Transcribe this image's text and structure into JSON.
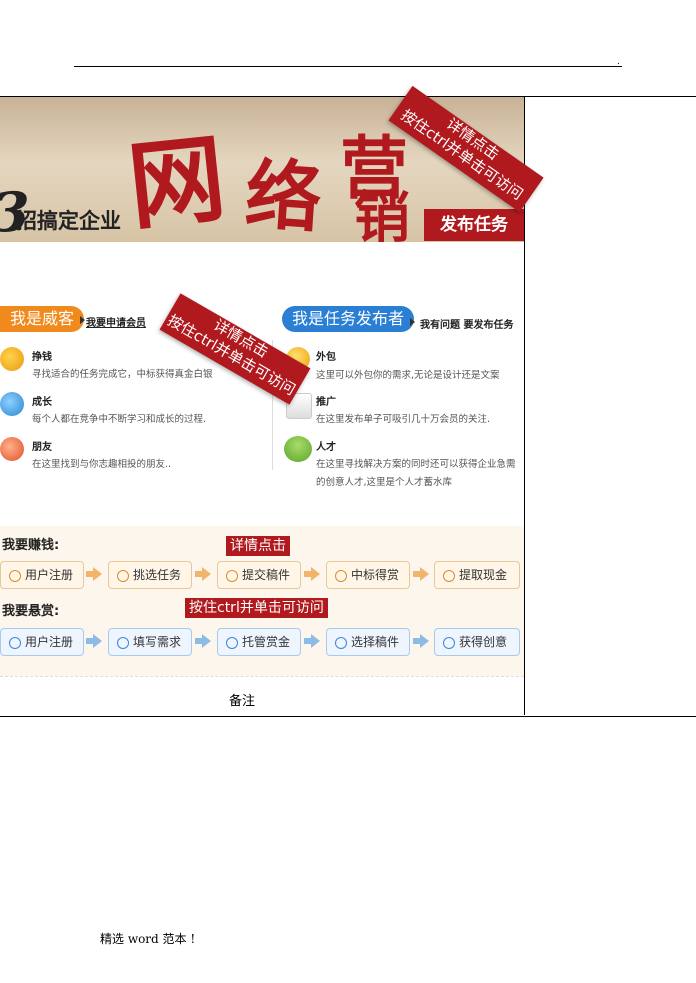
{
  "header": {
    "dot": "."
  },
  "banner": {
    "big_number": "3",
    "subtitle": "招搞定企业",
    "calligraphy": [
      "网",
      "络",
      "营",
      "销"
    ],
    "publish_button": "发布任务",
    "ribbon_top": "详情点击",
    "ribbon_bottom": "按住ctrl并单击可访问"
  },
  "left_panel": {
    "pill": "我是威客",
    "link": "我要申请会员",
    "items": [
      {
        "title": "挣钱",
        "desc": "寻找适合的任务完成它，中标获得真金白银"
      },
      {
        "title": "成长",
        "desc": "每个人都在竞争中不断学习和成长的过程."
      },
      {
        "title": "朋友",
        "desc": "在这里找到与你志趣相投的朋友.."
      }
    ]
  },
  "right_panel": {
    "pill": "我是任务发布者",
    "link": "我有问题 要发布任务",
    "items": [
      {
        "title": "外包",
        "desc": "这里可以外包你的需求,无论是设计还是文案"
      },
      {
        "title": "推广",
        "desc": "在这里发布单子可吸引几十万会员的关注."
      },
      {
        "title": "人才",
        "desc": "在这里寻找解决方案的同时还可以获得企业急需",
        "desc2": "的创意人才,这里是个人才蓄水库"
      }
    ]
  },
  "mid_ribbon": {
    "line1": "详情点击",
    "line2": "按住ctrl并单击可访问"
  },
  "flows": {
    "earn_label": "我要赚钱:",
    "earn_steps": [
      "用户注册",
      "挑选任务",
      "提交稿件",
      "中标得赏",
      "提取现金"
    ],
    "reward_label": "我要悬赏:",
    "reward_steps": [
      "用户注册",
      "填写需求",
      "托管赏金",
      "选择稿件",
      "获得创意"
    ],
    "tag_top": "详情点击",
    "tag_bottom": "按住ctrl并单击可访问"
  },
  "note": "备注",
  "footer": "精选 word 范本 !",
  "colors": {
    "brand_red": "#b01a1e",
    "orange": "#f08a1c",
    "blue": "#2a7fd4"
  }
}
